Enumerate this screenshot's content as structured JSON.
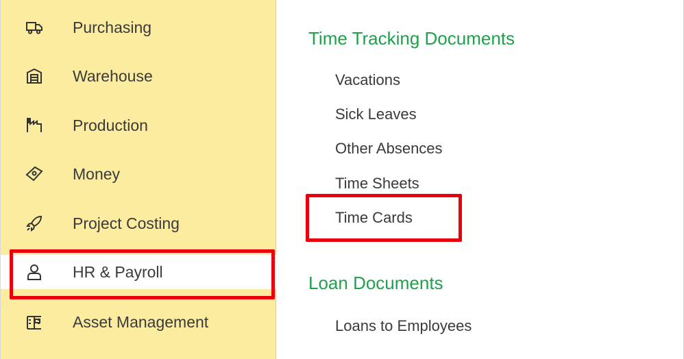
{
  "sidebar": {
    "items": [
      {
        "label": "Purchasing",
        "icon": "truck-icon"
      },
      {
        "label": "Warehouse",
        "icon": "warehouse-icon"
      },
      {
        "label": "Production",
        "icon": "factory-icon"
      },
      {
        "label": "Money",
        "icon": "money-icon"
      },
      {
        "label": "Project Costing",
        "icon": "rocket-icon"
      },
      {
        "label": "HR & Payroll",
        "icon": "person-icon"
      },
      {
        "label": "Asset Management",
        "icon": "asset-icon"
      }
    ],
    "active_index": 5
  },
  "content": {
    "sections": [
      {
        "title": "Time Tracking Documents",
        "links": [
          "Vacations",
          "Sick Leaves",
          "Other Absences",
          "Time Sheets",
          "Time Cards"
        ]
      },
      {
        "title": "Loan Documents",
        "links": [
          "Loans to Employees"
        ]
      }
    ]
  },
  "colors": {
    "sidebar_bg": "#fbeca0",
    "section_title": "#1fa04a",
    "highlight": "#e8000b",
    "text": "#3a3a3a"
  }
}
